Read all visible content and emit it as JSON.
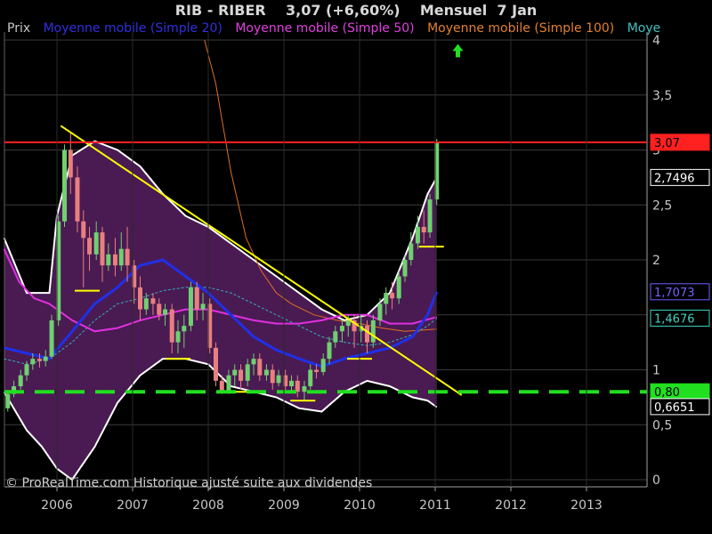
{
  "header": {
    "title": "RIB - RIBER    3,07 (+6,60%)    Mensuel  7 Jan"
  },
  "legend": [
    {
      "label": "Prix",
      "color": "#c8c8c8"
    },
    {
      "label": "Moyenne mobile (Simple 20)",
      "color": "#3030e0"
    },
    {
      "label": "Moyenne mobile (Simple 50)",
      "color": "#e040e0"
    },
    {
      "label": "Moyenne mobile (Simple 100)",
      "color": "#e08030"
    },
    {
      "label": "Moye",
      "color": "#40c0c0"
    }
  ],
  "copyright": "© ProRealTime.com Historique ajusté suite aux dividendes",
  "colors": {
    "background": "#000000",
    "band_fill": "#4a1a52",
    "band_edge": "#ffffff",
    "resistance": "#ff2020",
    "support_dashed": "#20e020",
    "trendline": "#ffff00",
    "sma20": "#2030e8",
    "sma50": "#e030e0",
    "sma100": "#e07020",
    "sma_cyan": "#30b0c0",
    "candle_up": "#70d070",
    "candle_down": "#e88080",
    "arrow": "#20e020"
  },
  "chart_data": {
    "type": "candlestick",
    "x_ticks": [
      "2006",
      "2007",
      "2008",
      "2009",
      "2010",
      "2011",
      "2012",
      "2013"
    ],
    "y_ticks": [
      "4",
      "3,5",
      "3",
      "2,5",
      "2",
      "1,5",
      "1",
      "0,5",
      "0"
    ],
    "y_range": [
      0,
      4.2
    ],
    "x_range": [
      2005.3,
      2013.8
    ],
    "price_labels": [
      {
        "text": "3,07",
        "value": 3.07,
        "bg": "#ff2020",
        "fg": "#000000",
        "border": "#ff2020"
      },
      {
        "text": "2,7496",
        "value": 2.75,
        "bg": "#000000",
        "fg": "#ffffff",
        "border": "#ffffff"
      },
      {
        "text": "1,7073",
        "value": 1.71,
        "bg": "#000000",
        "fg": "#7060ff",
        "border": "#7060ff"
      },
      {
        "text": "1,4676",
        "value": 1.47,
        "bg": "#000000",
        "fg": "#40d0c0",
        "border": "#40d0c0"
      },
      {
        "text": "0,80",
        "value": 0.8,
        "bg": "#20e020",
        "fg": "#000000",
        "border": "#20e020"
      },
      {
        "text": "0,6651",
        "value": 0.665,
        "bg": "#000000",
        "fg": "#ffffff",
        "border": "#ffffff"
      }
    ],
    "resistance": 3.07,
    "support": 0.8,
    "trendline": [
      [
        2006.05,
        3.22
      ],
      [
        2011.35,
        0.77
      ]
    ],
    "support_marks": [
      [
        2006.4,
        1.72
      ],
      [
        2007.6,
        1.1
      ],
      [
        2008.45,
        0.8
      ],
      [
        2009.25,
        0.72
      ],
      [
        2010.0,
        1.1
      ],
      [
        2010.95,
        2.12
      ]
    ],
    "arrow": {
      "x": 2011.3,
      "y": 3.9
    },
    "candles": [
      [
        2005.35,
        0.65,
        0.78,
        0.62,
        0.8
      ],
      [
        2005.43,
        0.78,
        0.85,
        0.75,
        0.9
      ],
      [
        2005.52,
        0.85,
        0.95,
        0.82,
        1.0
      ],
      [
        2005.6,
        0.95,
        1.05,
        0.9,
        1.08
      ],
      [
        2005.68,
        1.05,
        1.1,
        1.0,
        1.15
      ],
      [
        2005.77,
        1.1,
        1.08,
        1.02,
        1.15
      ],
      [
        2005.85,
        1.08,
        1.12,
        1.03,
        1.18
      ],
      [
        2005.93,
        1.12,
        1.45,
        1.1,
        1.5
      ],
      [
        2006.02,
        1.45,
        2.35,
        1.4,
        2.4
      ],
      [
        2006.1,
        2.35,
        3.0,
        2.3,
        3.05
      ],
      [
        2006.18,
        3.0,
        2.75,
        2.6,
        3.15
      ],
      [
        2006.27,
        2.75,
        2.35,
        2.25,
        2.85
      ],
      [
        2006.35,
        2.35,
        2.2,
        1.75,
        2.45
      ],
      [
        2006.43,
        2.2,
        2.05,
        1.9,
        2.3
      ],
      [
        2006.52,
        2.05,
        2.25,
        2.0,
        2.35
      ],
      [
        2006.6,
        2.25,
        1.95,
        1.8,
        2.3
      ],
      [
        2006.68,
        1.95,
        2.05,
        1.9,
        2.15
      ],
      [
        2006.77,
        2.05,
        1.95,
        1.85,
        2.2
      ],
      [
        2006.85,
        1.95,
        2.1,
        1.9,
        2.25
      ],
      [
        2006.93,
        2.1,
        1.95,
        1.8,
        2.3
      ],
      [
        2007.02,
        1.95,
        1.75,
        1.6,
        2.0
      ],
      [
        2007.1,
        1.75,
        1.55,
        1.45,
        1.85
      ],
      [
        2007.18,
        1.55,
        1.65,
        1.5,
        1.7
      ],
      [
        2007.27,
        1.65,
        1.6,
        1.5,
        1.7
      ],
      [
        2007.35,
        1.6,
        1.5,
        1.45,
        1.65
      ],
      [
        2007.43,
        1.5,
        1.55,
        1.4,
        1.6
      ],
      [
        2007.52,
        1.55,
        1.25,
        1.15,
        1.6
      ],
      [
        2007.6,
        1.25,
        1.35,
        1.15,
        1.45
      ],
      [
        2007.68,
        1.35,
        1.4,
        1.2,
        1.5
      ],
      [
        2007.77,
        1.4,
        1.75,
        1.35,
        1.8
      ],
      [
        2007.85,
        1.75,
        1.55,
        1.45,
        1.8
      ],
      [
        2007.93,
        1.55,
        1.6,
        1.45,
        1.7
      ],
      [
        2008.02,
        1.6,
        1.2,
        1.15,
        1.65
      ],
      [
        2008.1,
        1.2,
        0.9,
        0.85,
        1.25
      ],
      [
        2008.18,
        0.9,
        0.8,
        0.78,
        0.95
      ],
      [
        2008.27,
        0.8,
        0.95,
        0.78,
        1.0
      ],
      [
        2008.35,
        0.95,
        1.0,
        0.85,
        1.05
      ],
      [
        2008.43,
        1.0,
        0.9,
        0.82,
        1.05
      ],
      [
        2008.52,
        0.9,
        1.05,
        0.85,
        1.1
      ],
      [
        2008.6,
        1.05,
        1.1,
        0.95,
        1.15
      ],
      [
        2008.68,
        1.1,
        0.95,
        0.9,
        1.15
      ],
      [
        2008.77,
        0.95,
        1.0,
        0.9,
        1.05
      ],
      [
        2008.85,
        1.0,
        0.88,
        0.82,
        1.05
      ],
      [
        2008.93,
        0.88,
        0.95,
        0.85,
        1.0
      ],
      [
        2009.02,
        0.95,
        0.85,
        0.8,
        1.0
      ],
      [
        2009.1,
        0.85,
        0.9,
        0.8,
        0.95
      ],
      [
        2009.18,
        0.9,
        0.8,
        0.75,
        0.95
      ],
      [
        2009.27,
        0.8,
        0.85,
        0.72,
        0.9
      ],
      [
        2009.35,
        0.85,
        1.0,
        0.82,
        1.05
      ],
      [
        2009.43,
        1.0,
        0.98,
        0.92,
        1.05
      ],
      [
        2009.52,
        0.98,
        1.1,
        0.95,
        1.15
      ],
      [
        2009.6,
        1.1,
        1.25,
        1.05,
        1.3
      ],
      [
        2009.68,
        1.25,
        1.35,
        1.2,
        1.4
      ],
      [
        2009.77,
        1.35,
        1.4,
        1.25,
        1.45
      ],
      [
        2009.85,
        1.4,
        1.45,
        1.3,
        1.5
      ],
      [
        2009.93,
        1.45,
        1.35,
        1.2,
        1.5
      ],
      [
        2010.02,
        1.35,
        1.4,
        1.25,
        1.5
      ],
      [
        2010.1,
        1.4,
        1.25,
        1.15,
        1.45
      ],
      [
        2010.18,
        1.25,
        1.45,
        1.2,
        1.5
      ],
      [
        2010.27,
        1.45,
        1.6,
        1.4,
        1.65
      ],
      [
        2010.35,
        1.6,
        1.7,
        1.5,
        1.75
      ],
      [
        2010.43,
        1.7,
        1.65,
        1.55,
        1.8
      ],
      [
        2010.52,
        1.65,
        1.85,
        1.6,
        1.9
      ],
      [
        2010.6,
        1.85,
        2.0,
        1.8,
        2.05
      ],
      [
        2010.68,
        2.0,
        2.15,
        1.95,
        2.25
      ],
      [
        2010.77,
        2.15,
        2.3,
        2.1,
        2.4
      ],
      [
        2010.85,
        2.3,
        2.25,
        2.15,
        2.45
      ],
      [
        2010.93,
        2.25,
        2.55,
        2.2,
        2.6
      ],
      [
        2011.02,
        2.55,
        3.07,
        2.5,
        3.1
      ]
    ],
    "band_upper": [
      [
        2005.3,
        2.2
      ],
      [
        2005.6,
        1.7
      ],
      [
        2005.9,
        1.7
      ],
      [
        2006.0,
        2.4
      ],
      [
        2006.2,
        2.95
      ],
      [
        2006.5,
        3.08
      ],
      [
        2006.8,
        3.0
      ],
      [
        2007.1,
        2.85
      ],
      [
        2007.4,
        2.6
      ],
      [
        2007.7,
        2.4
      ],
      [
        2008.0,
        2.3
      ],
      [
        2008.3,
        2.15
      ],
      [
        2008.6,
        2.0
      ],
      [
        2008.9,
        1.85
      ],
      [
        2009.2,
        1.7
      ],
      [
        2009.5,
        1.55
      ],
      [
        2009.8,
        1.45
      ],
      [
        2010.1,
        1.5
      ],
      [
        2010.4,
        1.7
      ],
      [
        2010.7,
        2.2
      ],
      [
        2010.9,
        2.6
      ],
      [
        2011.02,
        2.75
      ]
    ],
    "band_lower": [
      [
        2005.3,
        0.8
      ],
      [
        2005.6,
        0.45
      ],
      [
        2005.8,
        0.3
      ],
      [
        2006.0,
        0.1
      ],
      [
        2006.2,
        0.0
      ],
      [
        2006.5,
        0.3
      ],
      [
        2006.8,
        0.7
      ],
      [
        2007.1,
        0.95
      ],
      [
        2007.4,
        1.1
      ],
      [
        2007.7,
        1.1
      ],
      [
        2008.0,
        1.05
      ],
      [
        2008.3,
        0.85
      ],
      [
        2008.6,
        0.8
      ],
      [
        2008.9,
        0.75
      ],
      [
        2009.2,
        0.65
      ],
      [
        2009.5,
        0.62
      ],
      [
        2009.8,
        0.8
      ],
      [
        2010.1,
        0.9
      ],
      [
        2010.4,
        0.85
      ],
      [
        2010.7,
        0.75
      ],
      [
        2010.9,
        0.72
      ],
      [
        2011.02,
        0.66
      ]
    ],
    "sma20": [
      [
        2005.3,
        1.2
      ],
      [
        2005.6,
        1.15
      ],
      [
        2005.9,
        1.1
      ],
      [
        2006.2,
        1.35
      ],
      [
        2006.5,
        1.6
      ],
      [
        2006.8,
        1.75
      ],
      [
        2007.1,
        1.95
      ],
      [
        2007.4,
        2.0
      ],
      [
        2007.7,
        1.85
      ],
      [
        2008.0,
        1.7
      ],
      [
        2008.3,
        1.5
      ],
      [
        2008.6,
        1.3
      ],
      [
        2008.9,
        1.18
      ],
      [
        2009.2,
        1.1
      ],
      [
        2009.5,
        1.03
      ],
      [
        2009.8,
        1.1
      ],
      [
        2010.1,
        1.15
      ],
      [
        2010.4,
        1.2
      ],
      [
        2010.7,
        1.3
      ],
      [
        2010.9,
        1.5
      ],
      [
        2011.02,
        1.71
      ]
    ],
    "sma50": [
      [
        2005.3,
        2.1
      ],
      [
        2005.5,
        1.8
      ],
      [
        2005.7,
        1.65
      ],
      [
        2005.9,
        1.6
      ],
      [
        2006.2,
        1.45
      ],
      [
        2006.5,
        1.35
      ],
      [
        2006.8,
        1.38
      ],
      [
        2007.1,
        1.45
      ],
      [
        2007.4,
        1.5
      ],
      [
        2007.7,
        1.55
      ],
      [
        2008.0,
        1.55
      ],
      [
        2008.3,
        1.5
      ],
      [
        2008.6,
        1.45
      ],
      [
        2008.9,
        1.42
      ],
      [
        2009.2,
        1.42
      ],
      [
        2009.5,
        1.45
      ],
      [
        2009.8,
        1.5
      ],
      [
        2010.1,
        1.5
      ],
      [
        2010.4,
        1.42
      ],
      [
        2010.7,
        1.42
      ],
      [
        2011.02,
        1.48
      ]
    ],
    "sma100": [
      [
        2007.95,
        4.0
      ],
      [
        2008.1,
        3.6
      ],
      [
        2008.3,
        2.8
      ],
      [
        2008.5,
        2.2
      ],
      [
        2008.7,
        1.9
      ],
      [
        2008.9,
        1.7
      ],
      [
        2009.1,
        1.6
      ],
      [
        2009.4,
        1.5
      ],
      [
        2009.7,
        1.45
      ],
      [
        2010.0,
        1.42
      ],
      [
        2010.3,
        1.38
      ],
      [
        2010.6,
        1.35
      ],
      [
        2011.02,
        1.37
      ]
    ],
    "sma_cyan": [
      [
        2005.3,
        1.1
      ],
      [
        2005.6,
        1.05
      ],
      [
        2005.9,
        1.1
      ],
      [
        2006.2,
        1.25
      ],
      [
        2006.5,
        1.45
      ],
      [
        2006.8,
        1.6
      ],
      [
        2007.1,
        1.65
      ],
      [
        2007.4,
        1.72
      ],
      [
        2007.7,
        1.75
      ],
      [
        2008.0,
        1.75
      ],
      [
        2008.3,
        1.7
      ],
      [
        2008.6,
        1.6
      ],
      [
        2008.9,
        1.5
      ],
      [
        2009.2,
        1.4
      ],
      [
        2009.5,
        1.3
      ],
      [
        2009.8,
        1.25
      ],
      [
        2010.1,
        1.22
      ],
      [
        2010.4,
        1.25
      ],
      [
        2010.7,
        1.32
      ],
      [
        2010.9,
        1.4
      ],
      [
        2011.02,
        1.47
      ]
    ]
  }
}
